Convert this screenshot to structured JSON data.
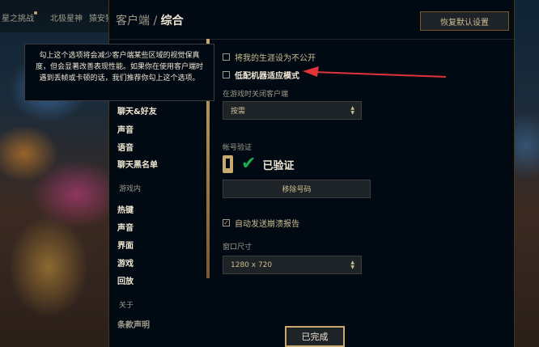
{
  "background": {
    "nav_items": [
      "星之挑战",
      "北极星神",
      "猿安猫"
    ]
  },
  "modal": {
    "title_section": "客户端",
    "title_separator": " / ",
    "title_page": "综合",
    "reset_button": "恢复默认设置",
    "done_button": "已完成"
  },
  "sidebar": {
    "items_top": [
      "聊天&好友",
      "声音",
      "语音",
      "聊天黑名单"
    ],
    "group_ingame": "游戏内",
    "items_ingame": [
      "热键",
      "声音",
      "界面",
      "游戏",
      "回放"
    ],
    "group_about": "关于",
    "items_about": [
      "条款声明"
    ]
  },
  "content": {
    "private_career_label": "将我的生涯设为不公开",
    "private_career_checked": false,
    "low_spec_label": "低配机器适应模式",
    "low_spec_checked": false,
    "close_client_label": "在游戏时关闭客户端",
    "close_client_value": "按需",
    "account_verify_label": "帐号验证",
    "verified_text": "已验证",
    "remove_number_button": "移除号码",
    "auto_crash_report_label": "自动发送崩溃报告",
    "auto_crash_report_checked": true,
    "window_size_label": "窗口尺寸",
    "window_size_value": "1280 x 720"
  },
  "tooltip": {
    "text": "勾上这个选项将会减少客户端某些区域的视觉保真度，但会显著改善表现性能。如果你在使用客户端时遇到丢帧或卡顿的话，我们推荐你勾上这个选项。"
  },
  "colors": {
    "gold": "#c8aa6e",
    "annotation_arrow": "#e0343a",
    "verified_check": "#1eab4e"
  }
}
